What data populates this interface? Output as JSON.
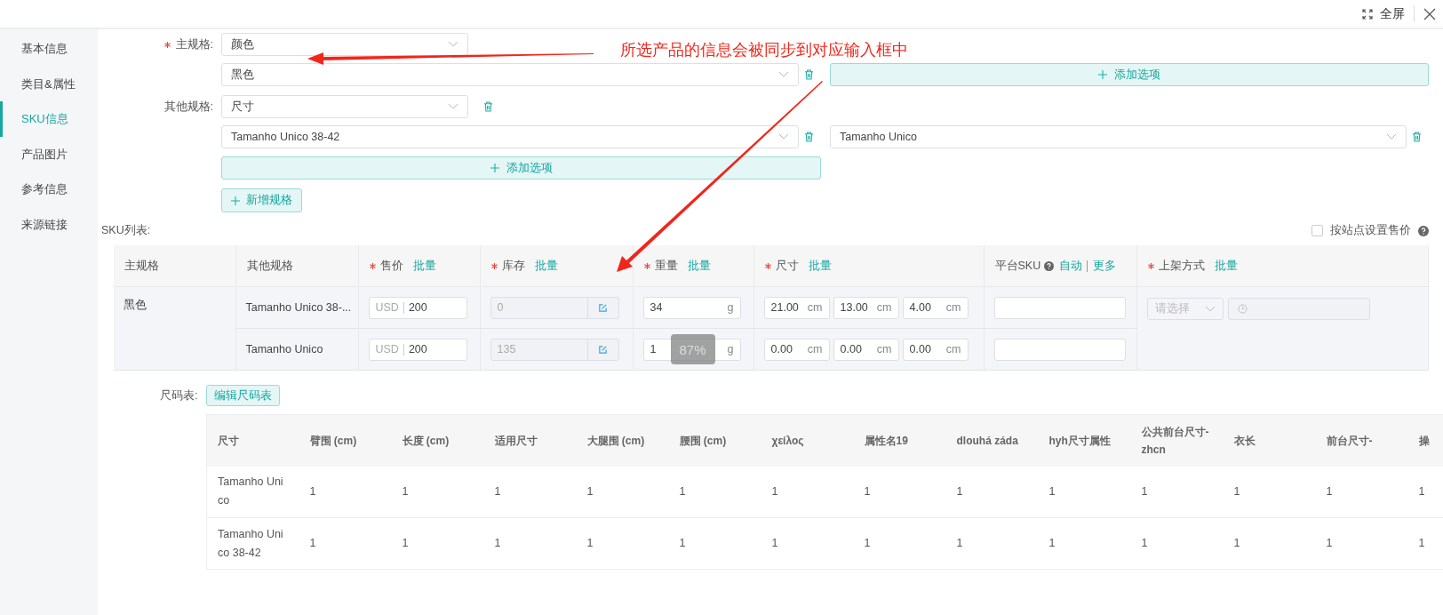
{
  "topbar": {
    "fullscreen_label": "全屏"
  },
  "sidebar": {
    "items": [
      {
        "label": "基本信息",
        "selected": false
      },
      {
        "label": "类目&属性",
        "selected": false
      },
      {
        "label": "SKU信息",
        "selected": true
      },
      {
        "label": "产品图片",
        "selected": false
      },
      {
        "label": "参考信息",
        "selected": false
      },
      {
        "label": "来源链接",
        "selected": false
      }
    ]
  },
  "annotation": {
    "text": "所选产品的信息会被同步到对应输入框中"
  },
  "specs": [
    {
      "label": "主规格:",
      "required": true,
      "value": "颜色",
      "deletable": false,
      "options": [
        "黑色"
      ],
      "add_option": "添加选项"
    },
    {
      "label": "其他规格:",
      "required": false,
      "value": "尺寸",
      "deletable": true,
      "options": [
        "Tamanho Unico 38-42",
        "Tamanho Unico"
      ],
      "add_option": "添加选项"
    }
  ],
  "add_spec_button": "新增规格",
  "sku_list": {
    "label": "SKU列表:",
    "site_price": {
      "label": "按站点设置售价",
      "checked": false
    },
    "columns": [
      {
        "label": "主规格",
        "required": false,
        "help": false
      },
      {
        "label": "其他规格",
        "required": false,
        "help": false
      },
      {
        "label": "售价",
        "required": true,
        "help": false,
        "links": [
          "批量"
        ]
      },
      {
        "label": "库存",
        "required": true,
        "help": false,
        "links": [
          "批量"
        ]
      },
      {
        "label": "重量",
        "required": true,
        "help": false,
        "links": [
          "批量"
        ]
      },
      {
        "label": "尺寸",
        "required": true,
        "help": false,
        "links": [
          "批量"
        ]
      },
      {
        "label": "平台SKU",
        "required": false,
        "help": true,
        "links": [
          "自动",
          "更多"
        ]
      },
      {
        "label": "上架方式",
        "required": true,
        "help": false,
        "links": [
          "批量"
        ]
      }
    ],
    "main_value": "黑色",
    "rows": [
      {
        "other": "Tamanho Unico 38-...",
        "currency": "USD",
        "price": "200",
        "stock": "0",
        "stock_disabled": true,
        "weight": "34",
        "weight_unit": "g",
        "dims": [
          {
            "value": "21.00",
            "unit": "cm"
          },
          {
            "value": "13.00",
            "unit": "cm"
          },
          {
            "value": "4.00",
            "unit": "cm"
          }
        ]
      },
      {
        "other": "Tamanho Unico",
        "currency": "USD",
        "price": "200",
        "stock": "135",
        "stock_disabled": true,
        "weight": "1",
        "weight_unit": "g",
        "overlay": "87%",
        "dims": [
          {
            "value": "0.00",
            "unit": "cm"
          },
          {
            "value": "0.00",
            "unit": "cm"
          },
          {
            "value": "0.00",
            "unit": "cm"
          }
        ]
      }
    ],
    "listing": {
      "placeholder": "请选择"
    }
  },
  "size_chart": {
    "label": "尺码表:",
    "edit_button": "编辑尺码表",
    "columns": [
      "尺寸",
      "臂围 (cm)",
      "长度 (cm)",
      "适用尺寸",
      "大腿围 (cm)",
      "腰围 (cm)",
      "χείλος",
      "属性名19",
      "dlouhá záda",
      "hyh尺寸属性",
      "公共前台尺寸-zhcn",
      "衣长",
      "前台尺寸-",
      "操"
    ],
    "rows": [
      [
        "Tamanho Unico",
        "1",
        "1",
        "1",
        "1",
        "1",
        "1",
        "1",
        "1",
        "1",
        "1",
        "1",
        "1",
        "1"
      ],
      [
        "Tamanho Unico 38-42",
        "1",
        "1",
        "1",
        "1",
        "1",
        "1",
        "1",
        "1",
        "1",
        "1",
        "1",
        "1",
        "1"
      ]
    ]
  }
}
